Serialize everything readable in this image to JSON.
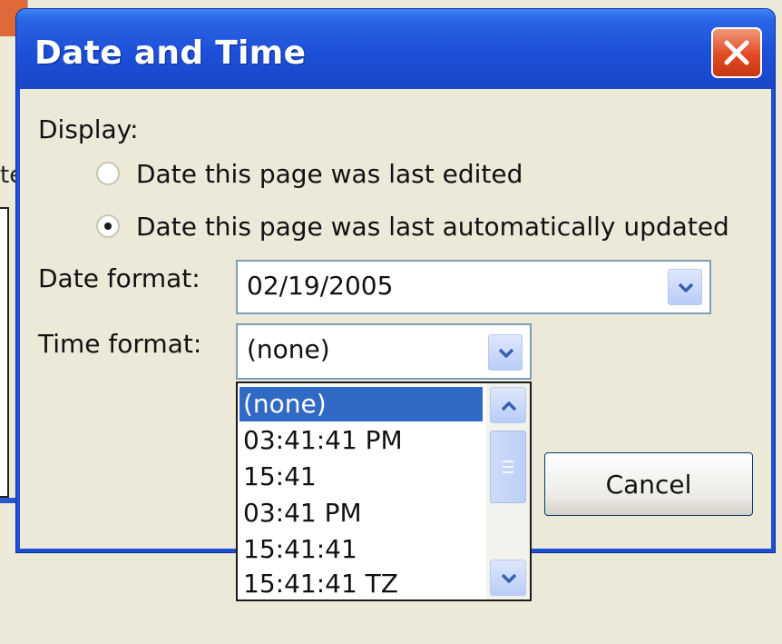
{
  "dialog": {
    "title": "Date and Time",
    "close_icon": "close-x-icon",
    "accent": "#1d4fd8",
    "close_color": "#e04a22"
  },
  "background": {
    "partial_text": "te"
  },
  "display": {
    "label": "Display:",
    "options": [
      {
        "label": "Date this page was last edited",
        "checked": false
      },
      {
        "label": "Date this page was last automatically updated",
        "checked": true
      }
    ]
  },
  "date_format": {
    "label": "Date format:",
    "value": "02/19/2005",
    "dropdown_icon": "chevron-down-icon"
  },
  "time_format": {
    "label": "Time format:",
    "value": "(none)",
    "dropdown_icon": "chevron-down-icon",
    "options": [
      "(none)",
      "03:41:41 PM",
      "15:41",
      "03:41 PM",
      "15:41:41",
      "15:41:41 TZ"
    ],
    "selected_index": 0,
    "selected_color": "#316ac5"
  },
  "buttons": {
    "cancel": "Cancel"
  }
}
